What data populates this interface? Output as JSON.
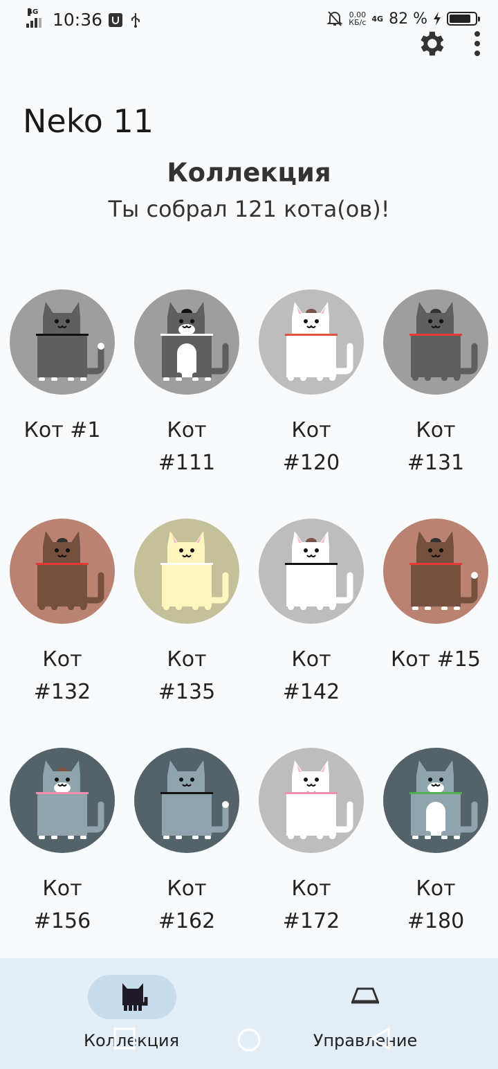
{
  "status_bar": {
    "network": "4G",
    "time": "10:36",
    "speed_value": "0.00",
    "speed_unit": "КБ/с",
    "mobile_data": "4G",
    "battery_percent": "82 %",
    "battery_level": 0.82
  },
  "app": {
    "title": "Neko 11"
  },
  "collection": {
    "heading": "Коллекция",
    "summary": "Ты собрал 121 кота(ов)!"
  },
  "cats": [
    {
      "label": "Кот #1",
      "bg": "#9e9e9e",
      "body": "#5f5f5f",
      "collar": "#111111",
      "face": "none",
      "cap": "none",
      "bib": "none",
      "paws": "#ffffff",
      "tailtip": "#ffffff"
    },
    {
      "label": "Кот #111",
      "bg": "#9e9e9e",
      "body": "#5f5f5f",
      "collar": "#ffffff",
      "face": "white",
      "cap": "#111111",
      "bib": "#ffffff",
      "paws": "#ffffff",
      "tailtip": "none"
    },
    {
      "label": "Кот #120",
      "bg": "#bdbdbd",
      "body": "#ffffff",
      "collar": "#e0533f",
      "face": "none",
      "cap": "#795548",
      "bib": "none",
      "paws": "none",
      "tailtip": "none"
    },
    {
      "label": "Кот #131",
      "bg": "#9e9e9e",
      "body": "#5f5f5f",
      "collar": "#e53935",
      "face": "none",
      "cap": "#333333",
      "bib": "none",
      "paws": "none",
      "tailtip": "none"
    },
    {
      "label": "Кот #132",
      "bg": "#b98271",
      "body": "#76503f",
      "collar": "#e53935",
      "face": "none",
      "cap": "#333333",
      "bib": "none",
      "paws": "none",
      "tailtip": "none"
    },
    {
      "label": "Кот #135",
      "bg": "#c3c09a",
      "body": "#fff6bf",
      "collar": "#ffffff",
      "face": "none",
      "cap": "none",
      "bib": "none",
      "paws": "none",
      "tailtip": "none"
    },
    {
      "label": "Кот #142",
      "bg": "#bdbdbd",
      "body": "#ffffff",
      "collar": "#111111",
      "face": "none",
      "cap": "#795548",
      "bib": "none",
      "paws": "none",
      "tailtip": "none"
    },
    {
      "label": "Кот #15",
      "bg": "#b98271",
      "body": "#76503f",
      "collar": "#e53935",
      "face": "none",
      "cap": "#333333",
      "bib": "none",
      "paws": "#ffffff",
      "tailtip": "#ffffff"
    },
    {
      "label": "Кот #156",
      "bg": "#546269",
      "body": "#90a4ae",
      "collar": "#f48fb1",
      "face": "white",
      "cap": "#795548",
      "bib": "none",
      "paws": "#ffffff",
      "tailtip": "none"
    },
    {
      "label": "Кот #162",
      "bg": "#546269",
      "body": "#90a4ae",
      "collar": "#111111",
      "face": "none",
      "cap": "none",
      "bib": "none",
      "paws": "#ffffff",
      "tailtip": "#ffffff"
    },
    {
      "label": "Кот #172",
      "bg": "#bdbdbd",
      "body": "#ffffff",
      "collar": "#f48fb1",
      "face": "none",
      "cap": "none",
      "bib": "none",
      "paws": "none",
      "tailtip": "none",
      "bow": "#f48fb1"
    },
    {
      "label": "Кот #180",
      "bg": "#546269",
      "body": "#90a4ae",
      "collar": "#4caf50",
      "face": "white",
      "cap": "none",
      "bib": "#ffffff",
      "paws": "#ffffff",
      "tailtip": "none"
    }
  ],
  "bottom_nav": {
    "items": [
      {
        "label": "Коллекция",
        "icon": "cat-icon",
        "selected": true
      },
      {
        "label": "Управление",
        "icon": "food-dish-icon",
        "selected": false
      }
    ]
  },
  "system_nav": {
    "icons": [
      "recent-apps-icon",
      "home-icon",
      "back-icon"
    ]
  }
}
